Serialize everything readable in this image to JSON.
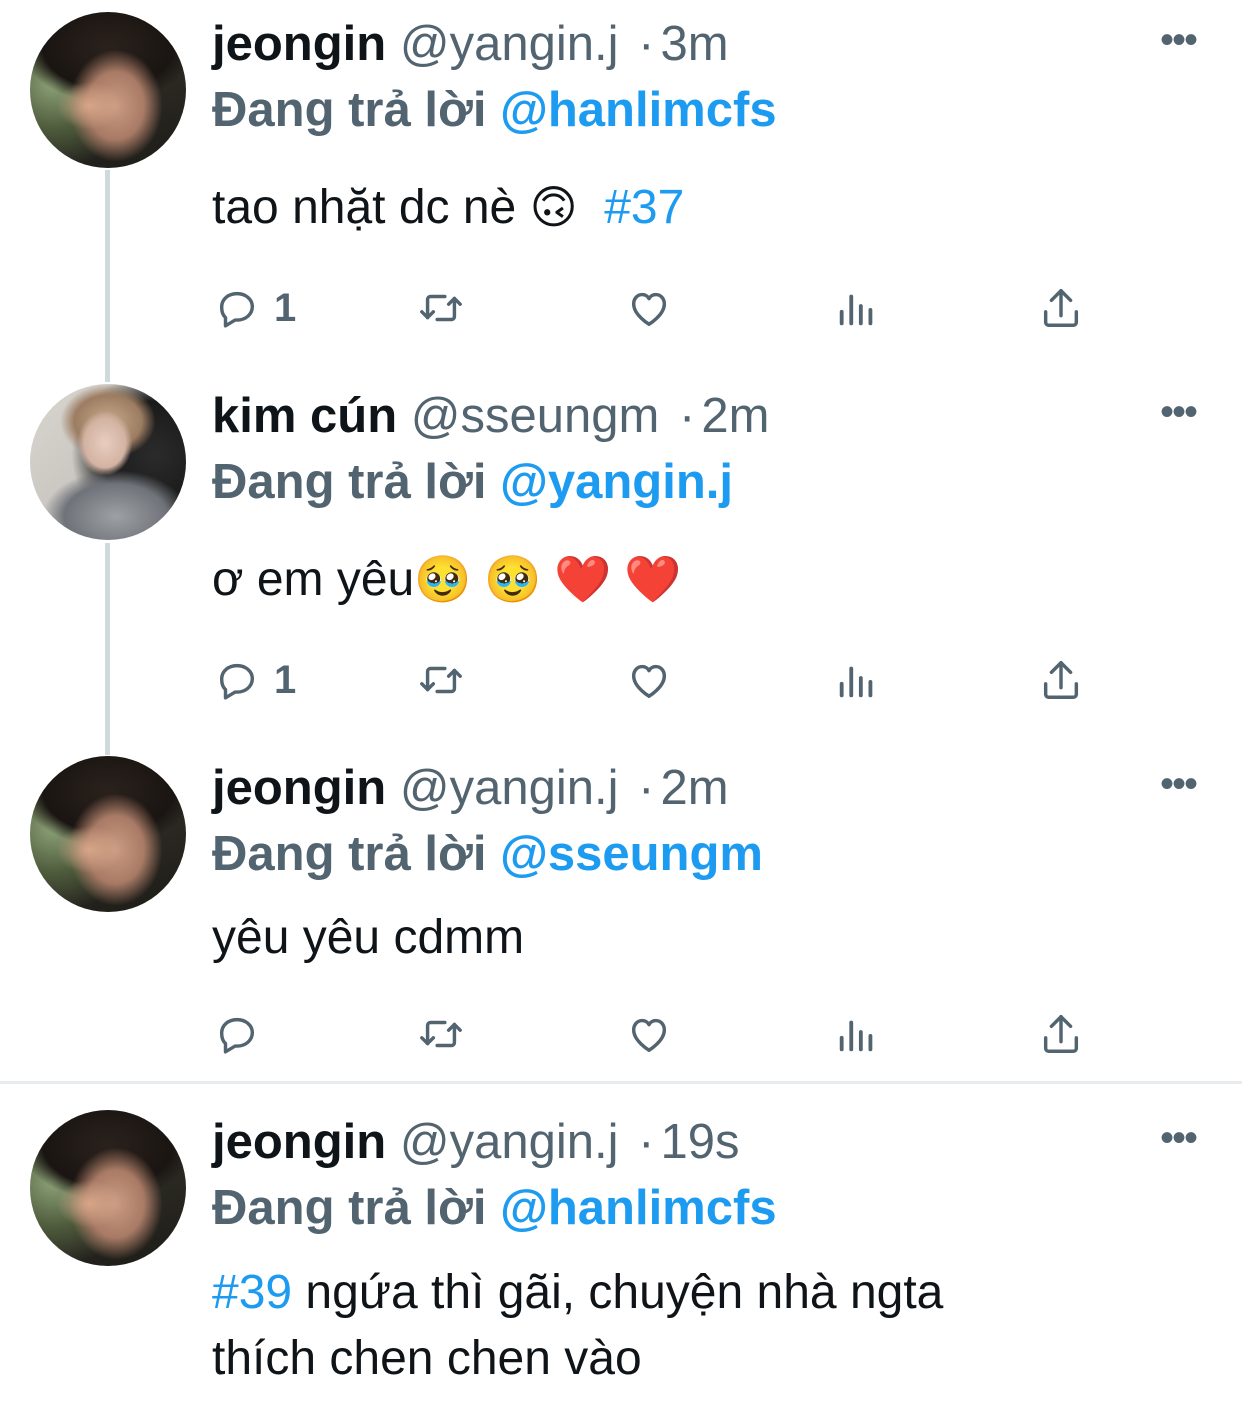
{
  "tweets": [
    {
      "name": "jeongin",
      "handle": "@yangin.j",
      "separator": "·",
      "time": "3m",
      "more_label": "•••",
      "reply_label": "Đang trả lời",
      "reply_to": "@hanlimcfs",
      "text_before": "tao nhặt dc nè ",
      "emoji": "🙃",
      "hashtag": "#37",
      "reply_count": "1"
    },
    {
      "name": "kim cún",
      "handle": "@sseungm",
      "separator": "·",
      "time": "2m",
      "more_label": "•••",
      "reply_label": "Đang trả lời",
      "reply_to": "@yangin.j",
      "text_before": "ơ em yêu",
      "emoji": "🥹 🥹 ❤️ ❤️",
      "reply_count": "1"
    },
    {
      "name": "jeongin",
      "handle": "@yangin.j",
      "separator": "·",
      "time": "2m",
      "more_label": "•••",
      "reply_label": "Đang trả lời",
      "reply_to": "@sseungm",
      "text": "yêu yêu cdmm",
      "reply_count": ""
    },
    {
      "name": "jeongin",
      "handle": "@yangin.j",
      "separator": "·",
      "time": "19s",
      "more_label": "•••",
      "reply_label": "Đang trả lời",
      "reply_to": "@hanlimcfs",
      "hashtag": "#39",
      "text_line1": " ngứa thì gãi, chuyện nhà ngta",
      "text_line2": "thích chen chen vào"
    }
  ],
  "icons": {
    "reply": "reply-icon",
    "retweet": "retweet-icon",
    "like": "heart-icon",
    "views": "views-icon",
    "share": "share-icon",
    "more": "more-icon"
  },
  "colors": {
    "accent": "#1d9bf0",
    "secondary_text": "#536471",
    "thread_line": "#cfd9de"
  }
}
